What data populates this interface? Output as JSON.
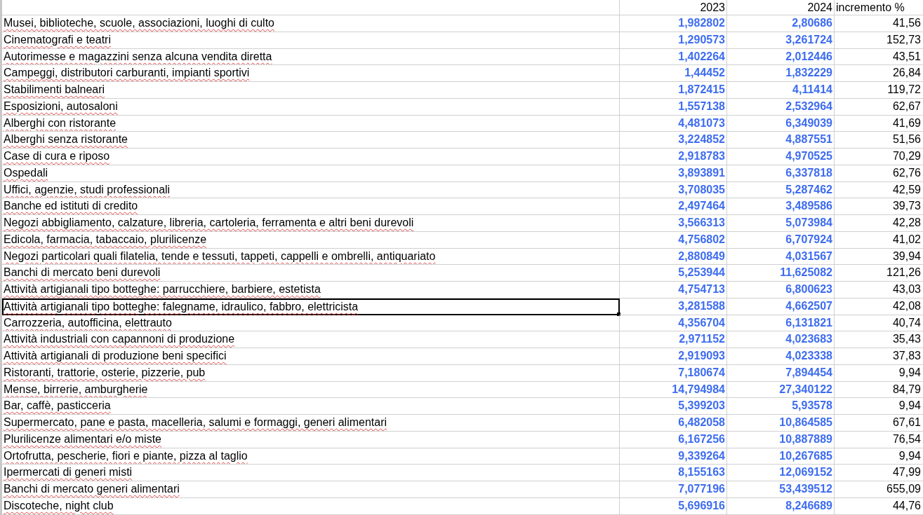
{
  "columns": [
    "2023",
    "2024",
    "incremento %"
  ],
  "rows": [
    {
      "label": "Musei, biblioteche, scuole, associazioni, luoghi di culto",
      "v2023": "1,982802",
      "v2024": "2,80686",
      "increment": "41,56",
      "selected": false
    },
    {
      "label": "Cinematografi e teatri",
      "v2023": "1,290573",
      "v2024": "3,261724",
      "increment": "152,73",
      "selected": false
    },
    {
      "label": "Autorimesse e magazzini senza alcuna vendita diretta",
      "v2023": "1,402264",
      "v2024": "2,012446",
      "increment": "43,51",
      "selected": false
    },
    {
      "label": "Campeggi, distributori carburanti, impianti sportivi",
      "v2023": "1,44452",
      "v2024": "1,832229",
      "increment": "26,84",
      "selected": false
    },
    {
      "label": "Stabilimenti balneari",
      "v2023": "1,872415",
      "v2024": "4,11414",
      "increment": "119,72",
      "selected": false
    },
    {
      "label": "Esposizioni, autosaloni",
      "v2023": "1,557138",
      "v2024": "2,532964",
      "increment": "62,67",
      "selected": false
    },
    {
      "label": "Alberghi con ristorante",
      "v2023": "4,481073",
      "v2024": "6,349039",
      "increment": "41,69",
      "selected": false
    },
    {
      "label": "Alberghi senza ristorante",
      "v2023": "3,224852",
      "v2024": "4,887551",
      "increment": "51,56",
      "selected": false
    },
    {
      "label": "Case di cura e riposo",
      "v2023": "2,918783",
      "v2024": "4,970525",
      "increment": "70,29",
      "selected": false
    },
    {
      "label": "Ospedali",
      "v2023": "3,893891",
      "v2024": "6,337818",
      "increment": "62,76",
      "selected": false
    },
    {
      "label": "Uffici, agenzie, studi professionali",
      "v2023": "3,708035",
      "v2024": "5,287462",
      "increment": "42,59",
      "selected": false
    },
    {
      "label": "Banche ed istituti di credito",
      "v2023": "2,497464",
      "v2024": "3,489586",
      "increment": "39,73",
      "selected": false
    },
    {
      "label": "Negozi abbigliamento, calzature, libreria, cartoleria, ferramenta e altri beni durevoli",
      "v2023": "3,566313",
      "v2024": "5,073984",
      "increment": "42,28",
      "selected": false
    },
    {
      "label": "Edicola, farmacia, tabaccaio, plurilicenze",
      "v2023": "4,756802",
      "v2024": "6,707924",
      "increment": "41,02",
      "selected": false
    },
    {
      "label": "Negozi particolari quali filatelia, tende e tessuti, tappeti, cappelli e ombrelli, antiquariato",
      "v2023": "2,880849",
      "v2024": "4,031567",
      "increment": "39,94",
      "selected": false
    },
    {
      "label": "Banchi di mercato beni durevoli",
      "v2023": "5,253944",
      "v2024": "11,625082",
      "increment": "121,26",
      "selected": false
    },
    {
      "label": "Attività artigianali tipo botteghe: parrucchiere, barbiere, estetista",
      "v2023": "4,754713",
      "v2024": "6,800623",
      "increment": "43,03",
      "selected": false
    },
    {
      "label": "Attività artigianali tipo botteghe: falegname, idraulico, fabbro, elettricista",
      "v2023": "3,281588",
      "v2024": "4,662507",
      "increment": "42,08",
      "selected": true
    },
    {
      "label": "Carrozzeria, autofficina, elettrauto",
      "v2023": "4,356704",
      "v2024": "6,131821",
      "increment": "40,74",
      "selected": false
    },
    {
      "label": "Attività industriali con capannoni di produzione",
      "v2023": "2,971152",
      "v2024": "4,023683",
      "increment": "35,43",
      "selected": false
    },
    {
      "label": "Attività artigianali di produzione beni specifici",
      "v2023": "2,919093",
      "v2024": "4,023338",
      "increment": "37,83",
      "selected": false
    },
    {
      "label": "Ristoranti, trattorie, osterie, pizzerie, pub",
      "v2023": "7,180674",
      "v2024": "7,894454",
      "increment": "9,94",
      "selected": false
    },
    {
      "label": "Mense, birrerie, amburgherie",
      "v2023": "14,794984",
      "v2024": "27,340122",
      "increment": "84,79",
      "selected": false
    },
    {
      "label": "Bar, caffè, pasticceria",
      "v2023": "5,399203",
      "v2024": "5,93578",
      "increment": "9,94",
      "selected": false
    },
    {
      "label": "Supermercato, pane e pasta, macelleria, salumi e formaggi, generi alimentari",
      "v2023": "6,482058",
      "v2024": "10,864585",
      "increment": "67,61",
      "selected": false
    },
    {
      "label": "Plurilicenze alimentari e/o miste",
      "v2023": "6,167256",
      "v2024": "10,887889",
      "increment": "76,54",
      "selected": false
    },
    {
      "label": "Ortofrutta, pescherie, fiori e piante, pizza al taglio",
      "v2023": "9,339264",
      "v2024": "10,267685",
      "increment": "9,94",
      "selected": false
    },
    {
      "label": "Ipermercati di generi misti",
      "v2023": "8,155163",
      "v2024": "12,069152",
      "increment": "47,99",
      "selected": false
    },
    {
      "label": "Banchi di mercato generi alimentari",
      "v2023": "7,077196",
      "v2024": "53,439512",
      "increment": "655,09",
      "selected": false
    },
    {
      "label": "Discoteche, night club",
      "v2023": "5,696916",
      "v2024": "8,246689",
      "increment": "44,76",
      "selected": false
    }
  ]
}
